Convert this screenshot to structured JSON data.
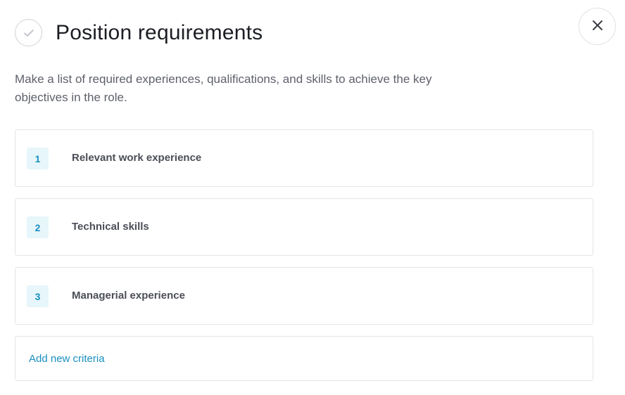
{
  "header": {
    "title": "Position requirements",
    "check_icon": "check-icon",
    "close_icon": "close-icon"
  },
  "description": "Make a list of required experiences, qualifications, and skills to achieve the key objectives in the role.",
  "criteria": [
    {
      "number": "1",
      "label": "Relevant work experience"
    },
    {
      "number": "2",
      "label": "Technical skills"
    },
    {
      "number": "3",
      "label": "Managerial experience"
    }
  ],
  "add_criteria_label": "Add new criteria",
  "colors": {
    "accent": "#1a8fbf",
    "badge_bg": "#e6f6fb",
    "border": "#e3e5ea",
    "title": "#1c1e24",
    "text": "#5e616b"
  }
}
